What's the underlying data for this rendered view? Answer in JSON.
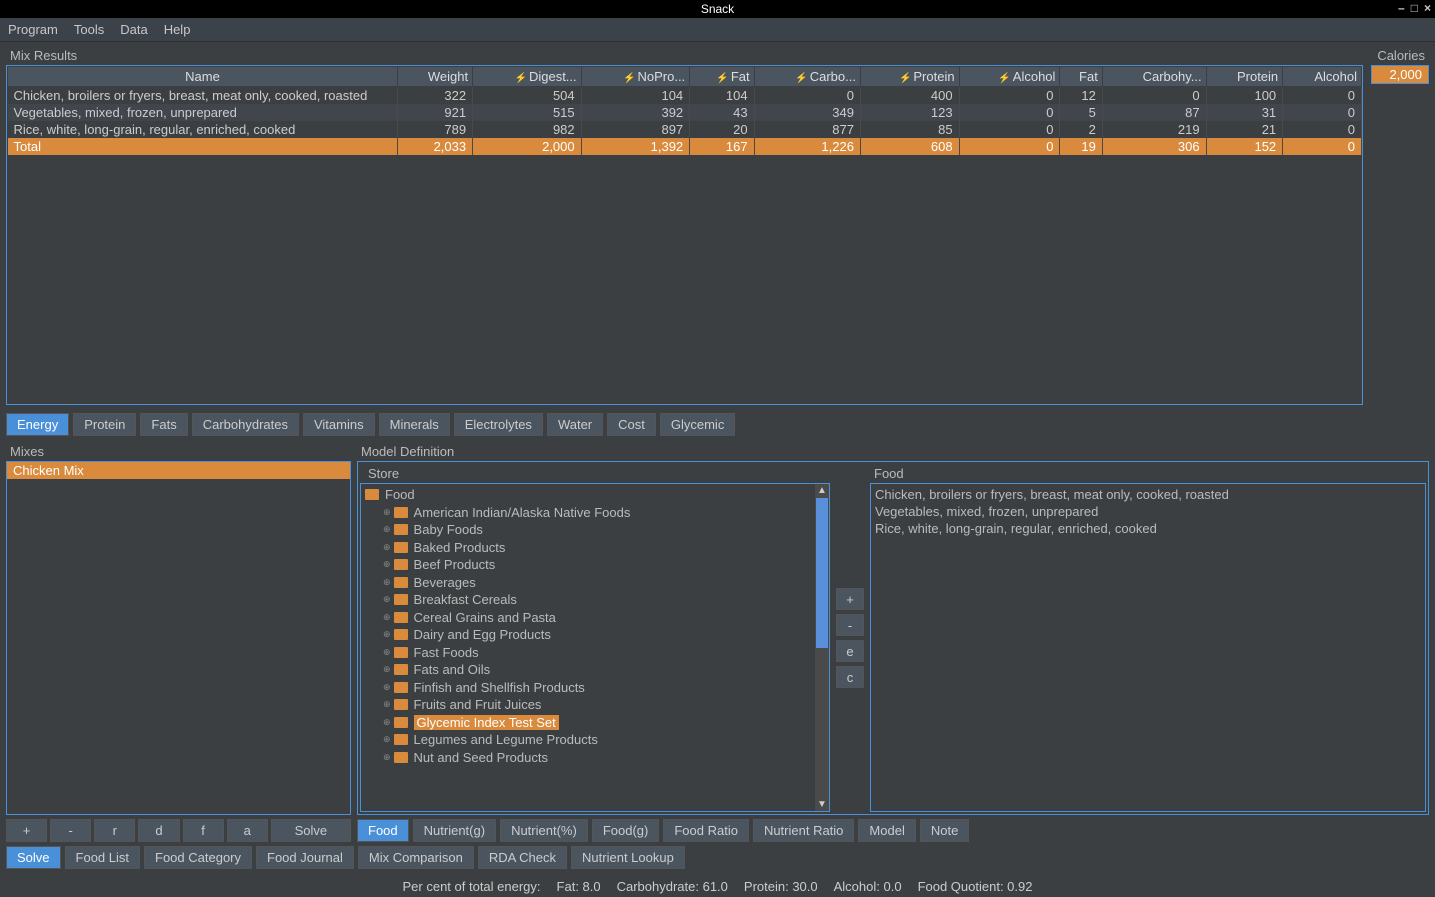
{
  "window": {
    "title": "Snack"
  },
  "menu": {
    "items": [
      "Program",
      "Tools",
      "Data",
      "Help"
    ]
  },
  "mix_results": {
    "title": "Mix Results",
    "columns": [
      "Name",
      "Weight",
      "Digest...",
      "NoPro...",
      "Fat",
      "Carbo...",
      "Protein",
      "Alcohol",
      "Fat",
      "Carbohy...",
      "Protein",
      "Alcohol"
    ],
    "rows": [
      {
        "name": "Chicken, broilers or fryers, breast, meat only, cooked, roasted",
        "vals": [
          "322",
          "504",
          "104",
          "104",
          "0",
          "400",
          "0",
          "12",
          "0",
          "100",
          "0"
        ]
      },
      {
        "name": "Vegetables, mixed, frozen, unprepared",
        "vals": [
          "921",
          "515",
          "392",
          "43",
          "349",
          "123",
          "0",
          "5",
          "87",
          "31",
          "0"
        ]
      },
      {
        "name": "Rice, white, long-grain, regular, enriched, cooked",
        "vals": [
          "789",
          "982",
          "897",
          "20",
          "877",
          "85",
          "0",
          "2",
          "219",
          "21",
          "0"
        ]
      }
    ],
    "total": {
      "name": "Total",
      "vals": [
        "2,033",
        "2,000",
        "1,392",
        "167",
        "1,226",
        "608",
        "0",
        "19",
        "306",
        "152",
        "0"
      ]
    }
  },
  "calories": {
    "label": "Calories",
    "value": "2,000"
  },
  "energy_tabs": [
    "Energy",
    "Protein",
    "Fats",
    "Carbohydrates",
    "Vitamins",
    "Minerals",
    "Electrolytes",
    "Water",
    "Cost",
    "Glycemic"
  ],
  "mixes": {
    "title": "Mixes",
    "items": [
      "Chicken Mix"
    ],
    "buttons": [
      "+",
      "-",
      "r",
      "d",
      "f",
      "a",
      "Solve"
    ]
  },
  "model": {
    "title": "Model Definition",
    "store_title": "Store",
    "food_title": "Food",
    "tree_root": "Food",
    "tree": [
      "American Indian/Alaska Native Foods",
      "Baby Foods",
      "Baked Products",
      "Beef Products",
      "Beverages",
      "Breakfast Cereals",
      "Cereal Grains and Pasta",
      "Dairy and Egg Products",
      "Fast Foods",
      "Fats and Oils",
      "Finfish and Shellfish Products",
      "Fruits and Fruit Juices",
      "Glycemic Index Test Set",
      "Legumes and Legume Products",
      "Nut and Seed Products"
    ],
    "tree_selected_index": 12,
    "mid_buttons": [
      "+",
      "-",
      "e",
      "c"
    ],
    "food_items": [
      "Chicken, broilers or fryers, breast, meat only, cooked, roasted",
      "Vegetables, mixed, frozen, unprepared",
      "Rice, white, long-grain, regular, enriched, cooked"
    ],
    "def_tabs": [
      "Food",
      "Nutrient(g)",
      "Nutrient(%)",
      "Food(g)",
      "Food Ratio",
      "Nutrient Ratio",
      "Model",
      "Note"
    ]
  },
  "main_tabs": [
    "Solve",
    "Food List",
    "Food Category",
    "Food Journal",
    "Mix Comparison",
    "RDA Check",
    "Nutrient Lookup"
  ],
  "status": {
    "label": "Per cent of total energy:",
    "fat": "Fat: 8.0",
    "carb": "Carbohydrate: 61.0",
    "protein": "Protein: 30.0",
    "alcohol": "Alcohol: 0.0",
    "fq": "Food Quotient: 0.92"
  }
}
